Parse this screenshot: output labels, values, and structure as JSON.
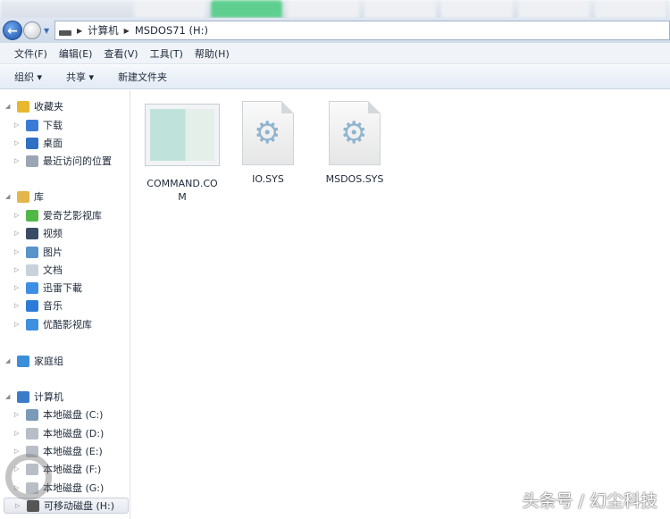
{
  "address": {
    "segments": [
      "计算机",
      "MSDOS71 (H:)"
    ]
  },
  "menu": [
    "文件(F)",
    "编辑(E)",
    "查看(V)",
    "工具(T)",
    "帮助(H)"
  ],
  "toolbar": {
    "organize": "组织 ▾",
    "share": "共享 ▾",
    "new_folder": "新建文件夹"
  },
  "sidebar": [
    {
      "label": "收藏夹",
      "level": 0,
      "color": "#e8b730"
    },
    {
      "label": "下载",
      "level": 1,
      "color": "#3a7bd5"
    },
    {
      "label": "桌面",
      "level": 1,
      "color": "#2f6fc4"
    },
    {
      "label": "最近访问的位置",
      "level": 1,
      "color": "#9aa6b4"
    },
    {
      "label": "库",
      "level": 0,
      "color": "#e2b64a"
    },
    {
      "label": "爱奇艺影视库",
      "level": 1,
      "color": "#51b848"
    },
    {
      "label": "视频",
      "level": 1,
      "color": "#3a4b66"
    },
    {
      "label": "图片",
      "level": 1,
      "color": "#5a93c9"
    },
    {
      "label": "文档",
      "level": 1,
      "color": "#c9d1dc"
    },
    {
      "label": "迅雷下載",
      "level": 1,
      "color": "#3e8ee6"
    },
    {
      "label": "音乐",
      "level": 1,
      "color": "#2c7bd6"
    },
    {
      "label": "优酷影视库",
      "level": 1,
      "color": "#3d8fe0"
    },
    {
      "label": "家庭组",
      "level": 0,
      "color": "#3d8ed8"
    },
    {
      "label": "计算机",
      "level": 0,
      "color": "#3a7cc8"
    },
    {
      "label": "本地磁盘 (C:)",
      "level": 1,
      "color": "#7a9ab8"
    },
    {
      "label": "本地磁盘 (D:)",
      "level": 1,
      "color": "#b8bec6"
    },
    {
      "label": "本地磁盘 (E:)",
      "level": 1,
      "color": "#b8bec6"
    },
    {
      "label": "本地磁盘 (F:)",
      "level": 1,
      "color": "#b8bec6"
    },
    {
      "label": "本地磁盘 (G:)",
      "level": 1,
      "color": "#b8bec6"
    },
    {
      "label": "可移动磁盘 (H:)",
      "level": 1,
      "color": "#555555"
    }
  ],
  "files": [
    {
      "name": "COMMAND.COM",
      "type": "app"
    },
    {
      "name": "IO.SYS",
      "type": "sys"
    },
    {
      "name": "MSDOS.SYS",
      "type": "sys"
    }
  ],
  "watermark": "头条号 / 幻尘科技"
}
